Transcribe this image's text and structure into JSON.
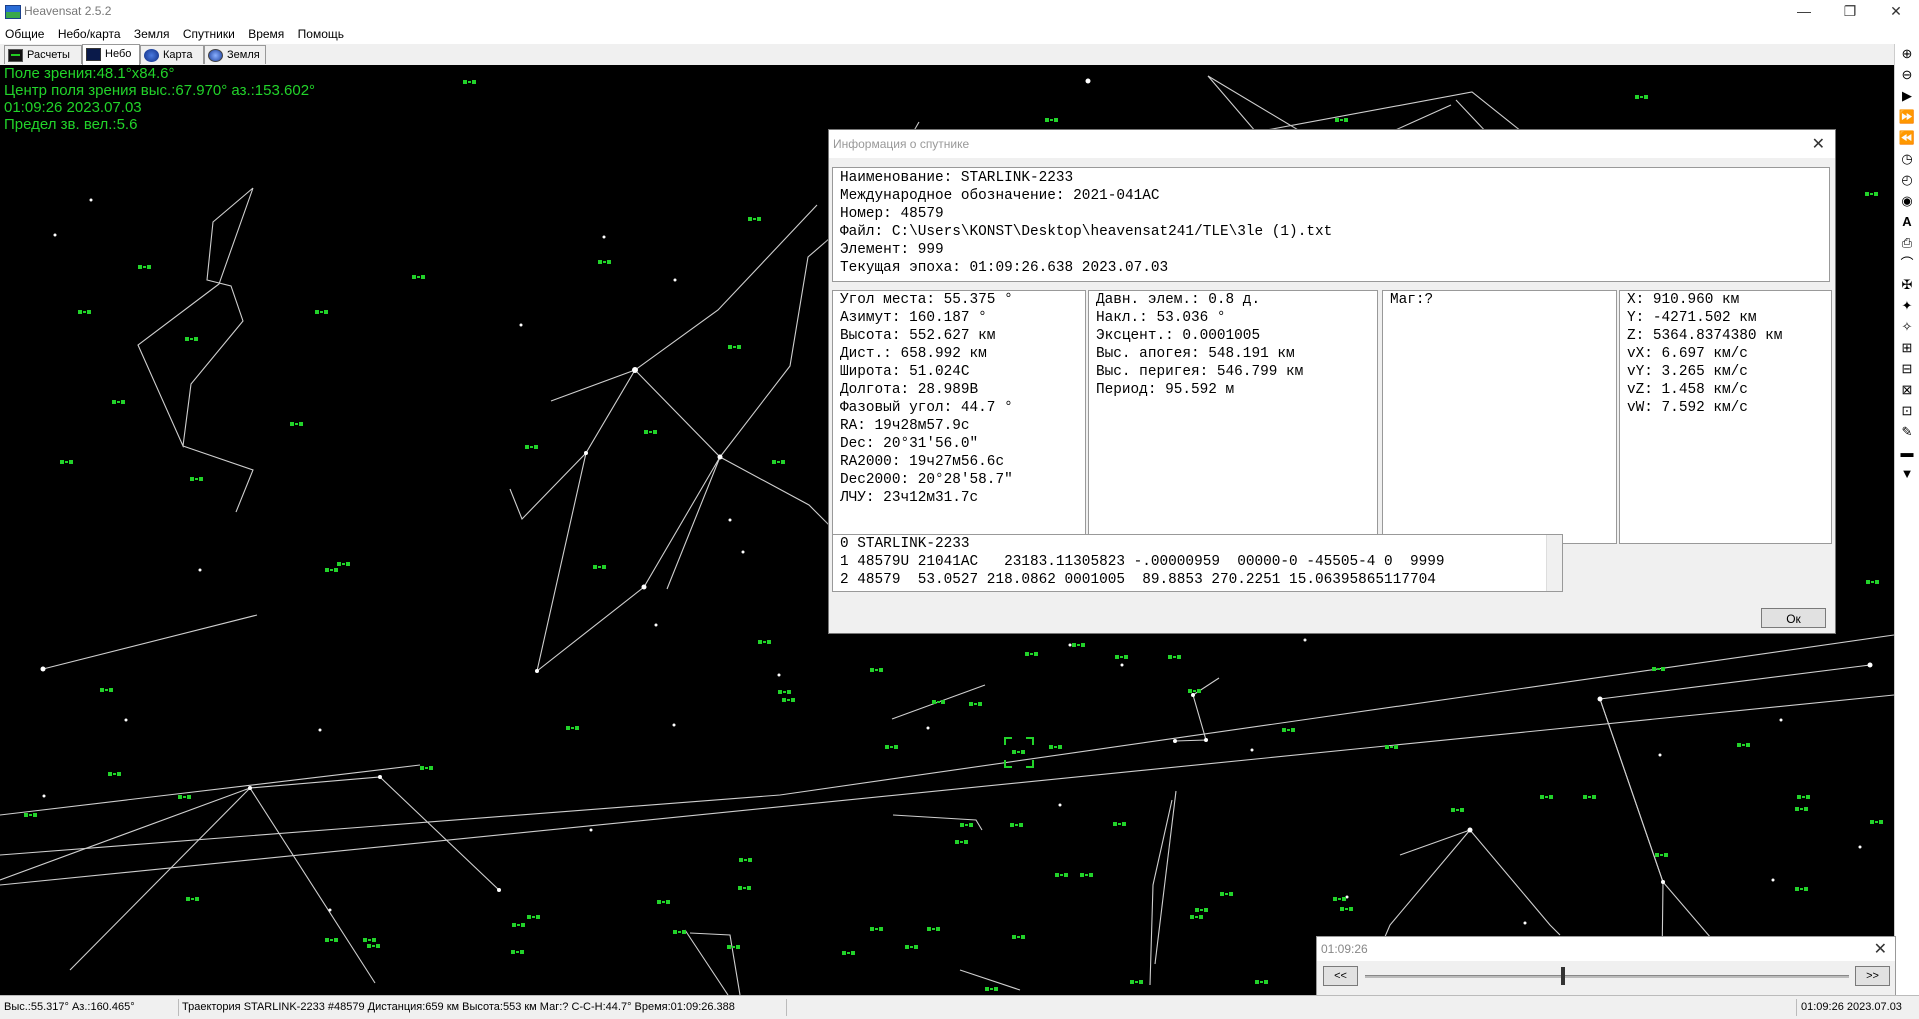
{
  "window": {
    "title": "Heavensat 2.5.2",
    "controls": [
      "minimize",
      "restore",
      "close"
    ]
  },
  "menu": [
    "Общие",
    "Небо/карта",
    "Земля",
    "Спутники",
    "Время",
    "Помощь"
  ],
  "tabs": [
    {
      "label": "Расчеты",
      "icon": "monitor-icon",
      "active": false
    },
    {
      "label": "Небо",
      "icon": "sky-icon",
      "active": true
    },
    {
      "label": "Карта",
      "icon": "globe-map-icon",
      "active": false
    },
    {
      "label": "Земля",
      "icon": "earth-icon",
      "active": false
    }
  ],
  "sky_overlay": {
    "field_of_view": "Поле зрения:48.1°x84.6°",
    "center": "Центр поля зрения выс.:67.970° аз.:153.602°",
    "datetime": "01:09:26 2023.07.03",
    "limit_mag": "Предел зв. вел.:5.6"
  },
  "sat_info_dialog": {
    "title": "Информация о спутнике",
    "close": "✕",
    "header_lines": [
      "Наименование: STARLINK-2233",
      "Международное обозначение: 2021-041AC",
      "Номер: 48579",
      "Файл: C:\\Users\\KONST\\Desktop\\heavensat241/TLE\\3le (1).txt",
      "Элемент: 999",
      "Текущая эпоха: 01:09:26.638 2023.07.03"
    ],
    "position_lines": [
      "Угол места: 55.375 °",
      "Азимут: 160.187 °",
      "Высота: 552.627 км",
      "Дист.: 658.992 км",
      "Широта: 51.024С",
      "Долгота: 28.989В",
      "Фазовый угол: 44.7 °",
      "RA: 19ч28м57.9с",
      "Dec: 20°31'56.0\"",
      "RA2000: 19ч27м56.6с",
      "Dec2000: 20°28'58.7\"",
      "ЛЧУ: 23ч12м31.7с"
    ],
    "orbit_lines": [
      "Давн. элем.: 0.8 д.",
      "Накл.: 53.036 °",
      "Эксцент.: 0.0001005",
      "Выс. апогея: 548.191 км",
      "Выс. перигея: 546.799 км",
      "Период: 95.592 м"
    ],
    "mag_lines": [
      "Маг:?"
    ],
    "vector_lines": [
      "X: 910.960 км",
      "Y: -4271.502 км",
      "Z: 5364.8374380 км",
      "vX: 6.697 км/с",
      "vY: 3.265 км/с",
      "vZ: 1.458 км/с",
      "vW: 7.592 км/с"
    ],
    "tle_lines": [
      "0 STARLINK-2233",
      "1 48579U 21041AC   23183.11305823 -.00000959  00000-0 -45505-4 0  9999",
      "2 48579  53.0527 218.0862 0001005  89.8853 270.2251 15.06395865117704"
    ],
    "ok_label": "Ок"
  },
  "time_dialog": {
    "title": "01:09:26",
    "close": "✕",
    "back_label": "<<",
    "forward_label": ">>",
    "slider_position": 0.41
  },
  "right_toolbar": [
    "zoom-in-icon",
    "zoom-out-icon",
    "play-icon",
    "fast-forward-icon",
    "rewind-icon",
    "clock-icon",
    "clock-reset-icon",
    "binoculars-icon",
    "font-icon",
    "print-icon",
    "horizon-icon",
    "satellite-icon",
    "satellite2-icon",
    "satellite3-icon",
    "satellite4-icon",
    "satellite5-icon",
    "satellite6-icon",
    "satellite7-icon",
    "pen-icon",
    "horizon2-icon",
    "telescope-icon"
  ],
  "status": {
    "altaz": "Выс.:55.317° Аз.:160.465°",
    "trajectory": "Траектория STARLINK-2233 #48579  Дистанция:659 км  Высота:553 км  Маг:? С-С-Н:44.7°  Время:01:09:26.388",
    "datetime": "01:09:26 2023.07.03"
  },
  "colors": {
    "sky_background": "#000000",
    "satellite_marker": "#22d32a",
    "overlay_text": "#22d32a",
    "constellation_lines": "#cfcfcf"
  }
}
